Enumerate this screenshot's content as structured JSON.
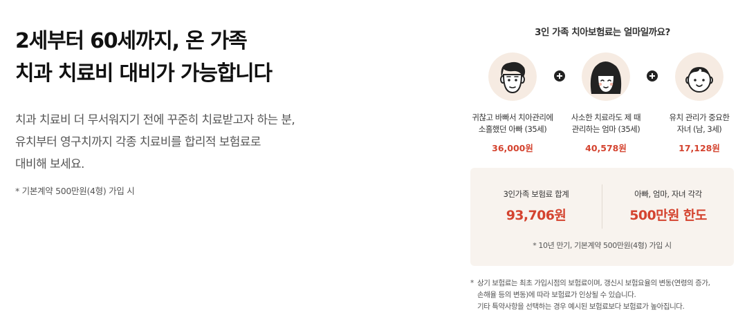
{
  "left": {
    "headline_line1": "2세부터 60세까지, 온 가족",
    "headline_line2": "치과 치료비 대비가 가능합니다",
    "desc_line1": "치과 치료비 더 무서워지기 전에 꾸준히 치료받고자 하는 분,",
    "desc_line2": "유치부터 영구치까지 각종 치료비를 합리적 보험료로",
    "desc_line3": "대비해 보세요.",
    "note": "* 기본계약 500만원(4형) 가입 시"
  },
  "right": {
    "title": "3인 가족 치아보험료는 얼마일까요?",
    "members": [
      {
        "icon": "father-avatar-icon",
        "label_line1": "귀찮고 바빠서 치아관리에",
        "label_line2": "소홀했던 아빠 (35세)",
        "price": "36,000원"
      },
      {
        "icon": "mother-avatar-icon",
        "label_line1": "사소한 치료라도 제 때",
        "label_line2": "관리하는 엄마 (35세)",
        "price": "40,578원"
      },
      {
        "icon": "child-avatar-icon",
        "label_line1": "유치 관리가 중요한",
        "label_line2": "자녀 (남, 3세)",
        "price": "17,128원"
      }
    ],
    "summary": {
      "total_label": "3인가족 보험료 합계",
      "total_value": "93,706원",
      "limit_label": "아빠, 엄마, 자녀 각각",
      "limit_value": "500만원 한도",
      "note": "* 10년 만기, 기본계약 500만원(4형) 가입 시"
    },
    "disclaimer": {
      "star": "*",
      "line1": "상기 보험료는 최초 가입시점의 보험료이며, 갱신시 보험요율의 변동(연령의 증가,",
      "line2": "손해율 등의 변동)에 따라 보험료가 인상될 수 있습니다.",
      "line3": "기타 특약사항을 선택하는 경우 예시된 보험료보다 보험료가 높아집니다."
    }
  },
  "colors": {
    "accent": "#d4432f",
    "avatar_bg": "#f6ebe2",
    "summary_bg": "#f8f3ee"
  }
}
